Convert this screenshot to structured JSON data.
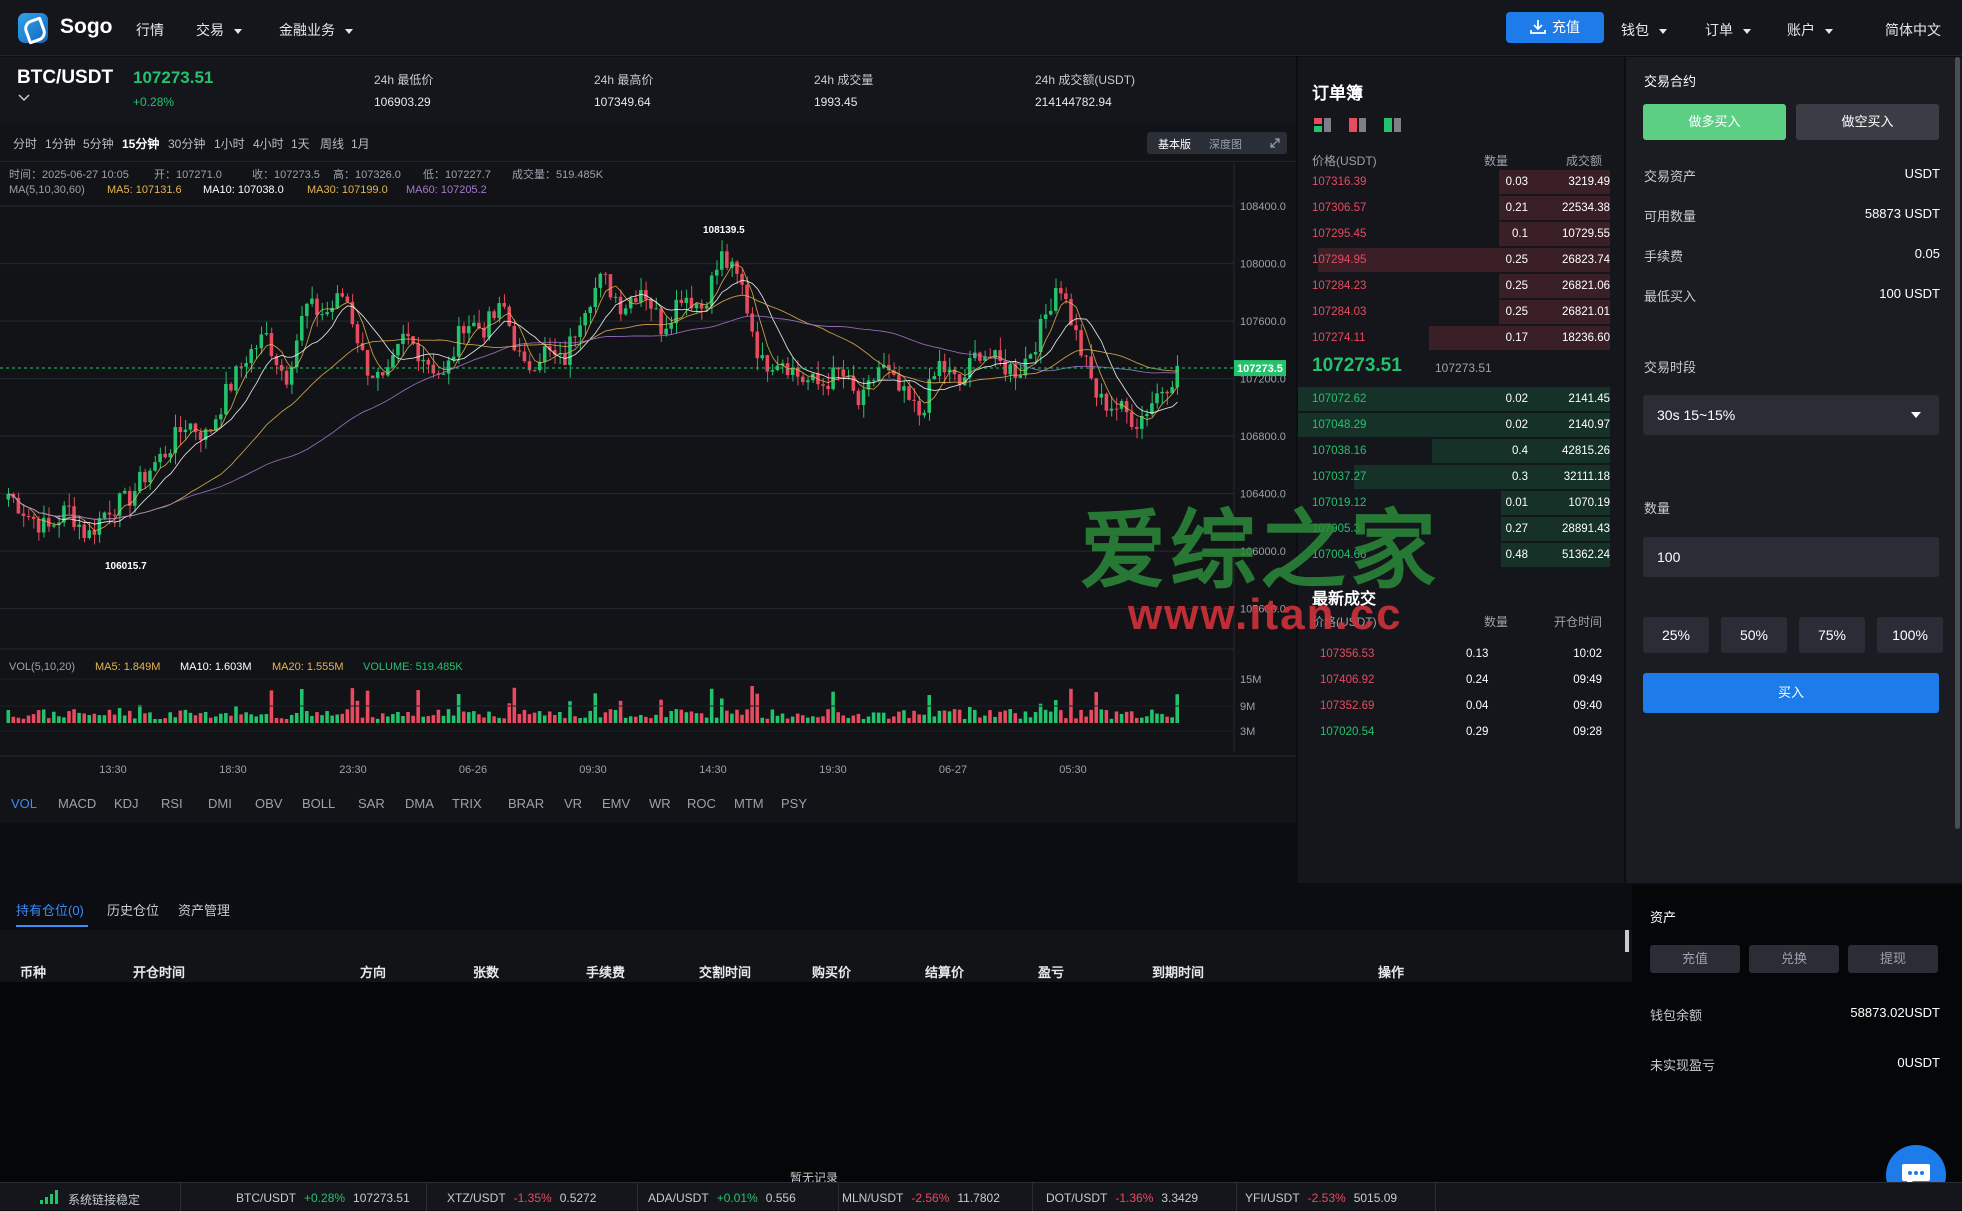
{
  "app": {
    "name": "Sogo"
  },
  "nav": {
    "items": [
      "行情",
      "交易",
      "金融业务"
    ],
    "recharge": "充值",
    "wallet": "钱包",
    "orders": "订单",
    "account": "账户",
    "lang": "简体中文"
  },
  "ticker": {
    "pair": "BTC/USDT",
    "last": "107273.51",
    "change": "+0.28%",
    "stats": [
      {
        "label": "24h 最低价",
        "value": "106903.29"
      },
      {
        "label": "24h 最高价",
        "value": "107349.64"
      },
      {
        "label": "24h 成交量",
        "value": "1993.45"
      },
      {
        "label": "24h 成交额(USDT)",
        "value": "214144782.94"
      }
    ]
  },
  "chart_toolbar": {
    "intervals": [
      "分时",
      "1分钟",
      "5分钟",
      "15分钟",
      "30分钟",
      "1小时",
      "4小时",
      "1天",
      "周线",
      "1月"
    ],
    "active_interval": "15分钟",
    "views": [
      "基本版",
      "深度图"
    ]
  },
  "chart_info": {
    "time": "时间：2025-06-27 10:05",
    "open": "开：107271.0",
    "close": "收：107273.5",
    "high": "高：107326.0",
    "low": "低：107227.7",
    "volume": "成交量：519.485K",
    "ma_label": "MA(5,10,30,60)",
    "ma5": "MA5: 107131.6",
    "ma10": "MA10: 107038.0",
    "ma30": "MA30: 107199.0",
    "ma60": "MA60: 107205.2",
    "vol_label": "VOL(5,10,20)",
    "vol_ma5": "MA5: 1.849M",
    "vol_ma10": "MA10: 1.603M",
    "vol_ma20": "MA20: 1.555M",
    "vol_volume": "VOLUME: 519.485K",
    "max_label": "108139.5",
    "min_label": "106015.7",
    "last_tag": "107273.5"
  },
  "chart_data": {
    "type": "candlestick",
    "price_ticks": [
      "108400.0",
      "108000.0",
      "107600.0",
      "107200.0",
      "106800.0",
      "106400.0",
      "106000.0",
      "105600.0"
    ],
    "volume_ticks": [
      "15M",
      "9M",
      "3M"
    ],
    "time_ticks": [
      "13:30",
      "18:30",
      "23:30",
      "06-26",
      "09:30",
      "14:30",
      "19:30",
      "06-27",
      "05:30"
    ],
    "ylim": [
      105500,
      108700
    ],
    "close_path": [
      106400,
      106250,
      106150,
      106300,
      106100,
      106300,
      106350,
      106550,
      106700,
      106900,
      106800,
      107100,
      107350,
      107500,
      107200,
      107700,
      107650,
      107800,
      107300,
      107150,
      107500,
      107350,
      107200,
      107600,
      107550,
      107700,
      107250,
      107400,
      107300,
      107700,
      107900,
      107700,
      107850,
      107550,
      107800,
      107700,
      108050,
      107850,
      107300,
      107350,
      107200,
      107150,
      107250,
      107000,
      107300,
      107100,
      106950,
      107300,
      107150,
      107400,
      107300,
      107250,
      107500,
      107900,
      107450,
      107050,
      107000,
      106900,
      107100,
      107250
    ]
  },
  "indicator_tabs": [
    "VOL",
    "MACD",
    "KDJ",
    "RSI",
    "DMI",
    "OBV",
    "BOLL",
    "SAR",
    "DMA",
    "TRIX",
    "BRAR",
    "VR",
    "EMV",
    "WR",
    "ROC",
    "MTM",
    "PSY"
  ],
  "orderbook": {
    "title": "订单簿",
    "headers": [
      "价格(USDT)",
      "数量",
      "成交额"
    ],
    "asks": [
      {
        "price": "107316.39",
        "qty": "0.03",
        "amount": "3219.49",
        "depth": 0.38
      },
      {
        "price": "107306.57",
        "qty": "0.21",
        "amount": "22534.38",
        "depth": 0.38
      },
      {
        "price": "107295.45",
        "qty": "0.1",
        "amount": "10729.55",
        "depth": 0.38
      },
      {
        "price": "107294.95",
        "qty": "0.25",
        "amount": "26823.74",
        "depth": 1.0
      },
      {
        "price": "107284.23",
        "qty": "0.25",
        "amount": "26821.06",
        "depth": 0.38
      },
      {
        "price": "107284.03",
        "qty": "0.25",
        "amount": "26821.01",
        "depth": 0.38
      },
      {
        "price": "107274.11",
        "qty": "0.17",
        "amount": "18236.60",
        "depth": 0.62
      }
    ],
    "mid_price": "107273.51",
    "mid_sub": "107273.51",
    "bids": [
      {
        "price": "107072.62",
        "qty": "0.02",
        "amount": "2141.45",
        "depth": 1.0
      },
      {
        "price": "107048.29",
        "qty": "0.02",
        "amount": "2140.97",
        "depth": 1.0
      },
      {
        "price": "107038.16",
        "qty": "0.4",
        "amount": "42815.26",
        "depth": 0.57
      },
      {
        "price": "107037.27",
        "qty": "0.3",
        "amount": "32111.18",
        "depth": 0.82
      },
      {
        "price": "107019.12",
        "qty": "0.01",
        "amount": "1070.19",
        "depth": 0.35
      },
      {
        "price": "107005.3",
        "qty": "0.27",
        "amount": "28891.43",
        "depth": 0.35
      },
      {
        "price": "107004.66",
        "qty": "0.48",
        "amount": "51362.24",
        "depth": 0.35
      }
    ],
    "trades_title": "最新成交",
    "trade_headers": [
      "价格(USDT)",
      "数量",
      "开仓时间"
    ],
    "trades": [
      {
        "price": "107356.53",
        "qty": "0.13",
        "time": "10:02",
        "side": "down"
      },
      {
        "price": "107406.92",
        "qty": "0.24",
        "time": "09:49",
        "side": "down"
      },
      {
        "price": "107352.69",
        "qty": "0.04",
        "time": "09:40",
        "side": "down"
      },
      {
        "price": "107020.54",
        "qty": "0.29",
        "time": "09:28",
        "side": "up"
      }
    ]
  },
  "trade_panel": {
    "title": "交易合约",
    "buy_long": "做多买入",
    "buy_short": "做空买入",
    "rows": [
      {
        "label": "交易资产",
        "value": "USDT"
      },
      {
        "label": "可用数量",
        "value": "58873 USDT"
      },
      {
        "label": "手续费",
        "value": "0.05"
      },
      {
        "label": "最低买入",
        "value": "100 USDT"
      }
    ],
    "period_label": "交易时段",
    "period_value": "30s 15~15%",
    "qty_label": "数量",
    "qty_value": "100",
    "pcts": [
      "25%",
      "50%",
      "75%",
      "100%"
    ],
    "submit": "买入"
  },
  "positions": {
    "tabs": [
      "持有仓位(0)",
      "历史仓位",
      "资产管理"
    ],
    "columns": [
      "币种",
      "开仓时间",
      "方向",
      "张数",
      "手续费",
      "交割时间",
      "购买价",
      "结算价",
      "盈亏",
      "到期时间",
      "操作"
    ],
    "empty": "暂无记录"
  },
  "assets": {
    "title": "资产",
    "buttons": [
      "充值",
      "兑换",
      "提现"
    ],
    "wallet_label": "钱包余额",
    "wallet_value": "58873.02USDT",
    "pnl_label": "未实现盈亏",
    "pnl_value": "0USDT"
  },
  "statusbar": {
    "status": "系统链接稳定",
    "tickers": [
      {
        "pair": "BTC/USDT",
        "chg": "+0.28%",
        "price": "107273.51",
        "side": "up"
      },
      {
        "pair": "XTZ/USDT",
        "chg": "-1.35%",
        "price": "0.5272",
        "side": "down"
      },
      {
        "pair": "ADA/USDT",
        "chg": "+0.01%",
        "price": "0.556",
        "side": "up"
      },
      {
        "pair": "MLN/USDT",
        "chg": "-2.56%",
        "price": "11.7802",
        "side": "down"
      },
      {
        "pair": "DOT/USDT",
        "chg": "-1.36%",
        "price": "3.3429",
        "side": "down"
      },
      {
        "pair": "YFI/USDT",
        "chg": "-2.53%",
        "price": "5015.09",
        "side": "down"
      }
    ]
  },
  "watermark": {
    "cn": "爱综之家",
    "url": "www.itan.cc"
  },
  "colors": {
    "up": "#25c26e",
    "down": "#e84a5f",
    "accent": "#1e7bea"
  }
}
